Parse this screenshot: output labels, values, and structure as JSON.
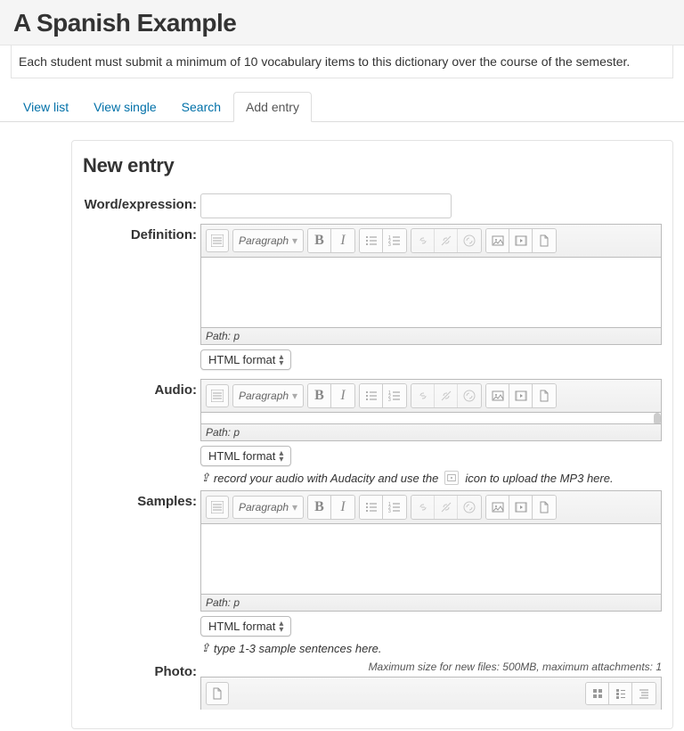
{
  "header": {
    "title": "A Spanish Example"
  },
  "intro": "Each student must submit a minimum of 10 vocabulary items to this dictionary over the course of the semester.",
  "tabs": {
    "view_list": "View list",
    "view_single": "View single",
    "search": "Search",
    "add_entry": "Add entry"
  },
  "form": {
    "heading": "New entry",
    "labels": {
      "word": "Word/expression:",
      "definition": "Definition:",
      "audio": "Audio:",
      "samples": "Samples:",
      "photo": "Photo:"
    }
  },
  "editor": {
    "format_dropdown": "Paragraph",
    "path_label": "Path: p",
    "html_format": "HTML format"
  },
  "hints": {
    "audio_pre": "record your audio with Audacity and use the",
    "audio_post": "icon to upload the MP3 here.",
    "samples": "type 1-3 sample sentences here."
  },
  "photo": {
    "limits": "Maximum size for new files: 500MB, maximum attachments: 1"
  }
}
